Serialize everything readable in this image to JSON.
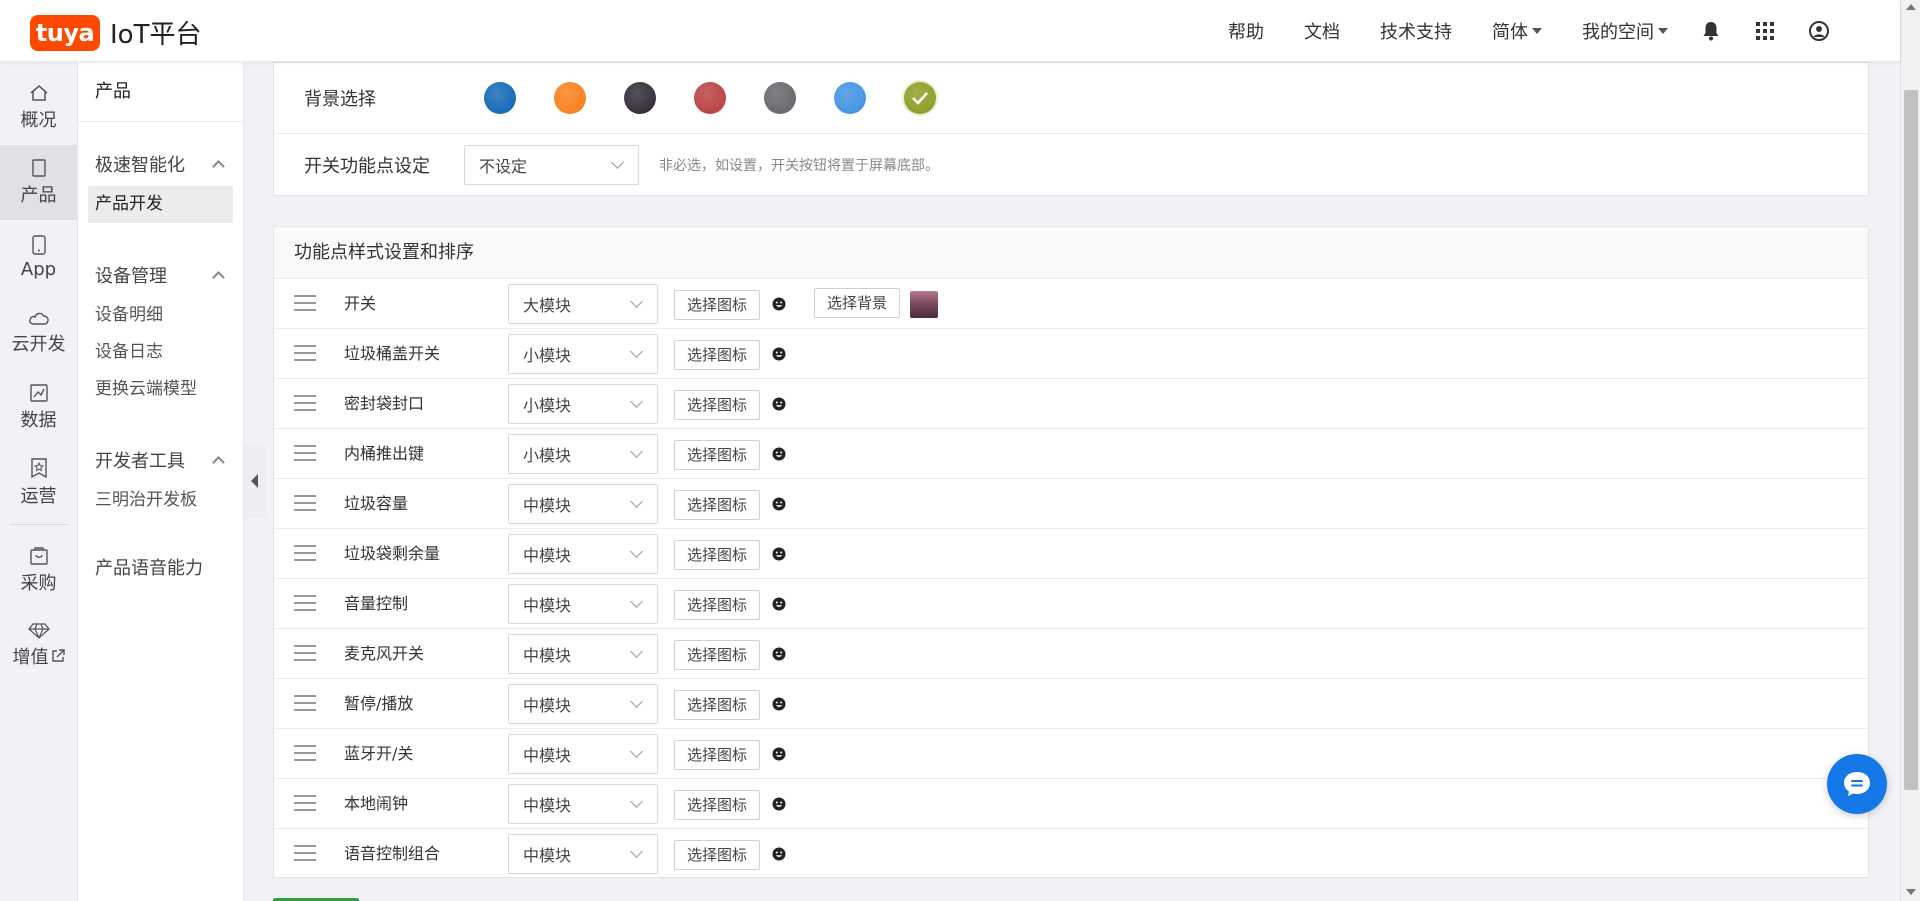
{
  "header": {
    "logo_badge": "tuya",
    "logo_text": "IoT平台",
    "nav": [
      {
        "label": "帮助"
      },
      {
        "label": "文档"
      },
      {
        "label": "技术支持"
      },
      {
        "label": "简体"
      },
      {
        "label": "我的空间"
      }
    ]
  },
  "rail": [
    {
      "label": "概况",
      "icon": "home-icon"
    },
    {
      "label": "产品",
      "icon": "product-icon",
      "active": true
    },
    {
      "label": "App",
      "icon": "phone-icon"
    },
    {
      "label": "云开发",
      "icon": "cloud-icon"
    },
    {
      "label": "数据",
      "icon": "chart-icon"
    },
    {
      "label": "运营",
      "icon": "bookmark-icon"
    },
    {
      "label": "采购",
      "icon": "cart-icon"
    },
    {
      "label": "增值",
      "icon": "diamond-icon"
    }
  ],
  "subnav": {
    "title": "产品",
    "groups": [
      {
        "title": "极速智能化",
        "items": [
          "产品开发"
        ]
      },
      {
        "title": "设备管理",
        "items": [
          "设备明细",
          "设备日志",
          "更换云端模型"
        ]
      },
      {
        "title": "开发者工具",
        "items": [
          "三明治开发板"
        ]
      }
    ],
    "extra": "产品语音能力"
  },
  "background": {
    "label": "背景选择",
    "swatches": [
      "#0a64b4",
      "#f97b13",
      "#2a2530",
      "#b83a3a",
      "#606265",
      "#3b8fe0",
      "#8a9a1e"
    ],
    "selected_index": 6
  },
  "switch_setting": {
    "label": "开关功能点设定",
    "value": "不设定",
    "hint": "非必选，如设置，开关按钮将置于屏幕底部。"
  },
  "dp_section": {
    "title": "功能点样式设置和排序",
    "icon_button": "选择图标",
    "bg_button": "选择背景",
    "rows": [
      {
        "name": "开关",
        "style": "大模块"
      },
      {
        "name": "垃圾桶盖开关",
        "style": "小模块"
      },
      {
        "name": "密封袋封口",
        "style": "小模块"
      },
      {
        "name": "内桶推出键",
        "style": "小模块"
      },
      {
        "name": "垃圾容量",
        "style": "中模块"
      },
      {
        "name": "垃圾袋剩余量",
        "style": "中模块"
      },
      {
        "name": "音量控制",
        "style": "中模块"
      },
      {
        "name": "麦克风开关",
        "style": "中模块"
      },
      {
        "name": "暂停/播放",
        "style": "中模块"
      },
      {
        "name": "蓝牙开/关",
        "style": "中模块"
      },
      {
        "name": "本地闹钟",
        "style": "中模块"
      },
      {
        "name": "语音控制组合",
        "style": "中模块"
      }
    ]
  }
}
